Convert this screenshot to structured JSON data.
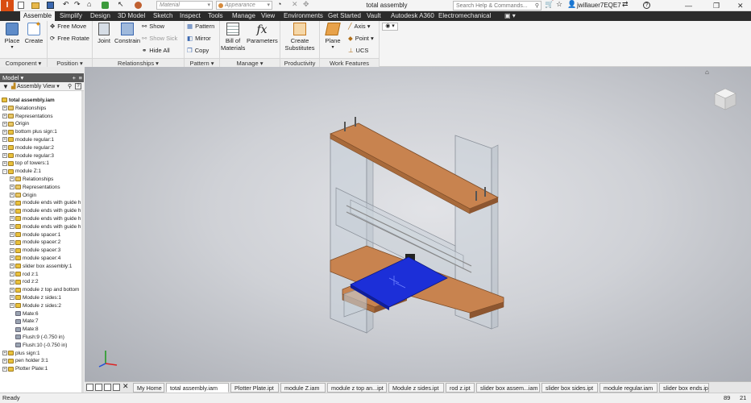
{
  "title_bar": {
    "material_placeholder": "Material",
    "appearance_placeholder": "Appearance",
    "doc_title": "total assembly",
    "search_placeholder": "Search Help & Commands...",
    "username": "jwillauer7EQE7",
    "help_label": "?"
  },
  "ribbon_tabs": [
    "Assemble",
    "Simplify",
    "Design",
    "3D Model",
    "Sketch",
    "Inspect",
    "Tools",
    "Manage",
    "View",
    "Environments",
    "Get Started",
    "Vault",
    "Autodesk A360",
    "Electromechanical"
  ],
  "ribbon": {
    "place": "Place",
    "create": "Create",
    "free_move": "Free Move",
    "free_rotate": "Free Rotate",
    "joint": "Joint",
    "constrain": "Constrain",
    "show": "Show",
    "show_sick": "Show Sick",
    "hide_all": "Hide All",
    "pattern": "Pattern",
    "mirror": "Mirror",
    "copy": "Copy",
    "bill_of_materials": "Bill of Materials",
    "parameters": "Parameters",
    "create_substitutes": "Create Substitutes",
    "plane": "Plane",
    "axis": "Axis",
    "point": "Point",
    "ucs": "UCS"
  },
  "panels": {
    "component": "Component",
    "position": "Position",
    "relationships": "Relationships",
    "pattern": "Pattern",
    "manage": "Manage",
    "productivity": "Productivity",
    "work_features": "Work Features"
  },
  "browser": {
    "header": "Model",
    "view": "Assembly View",
    "items": [
      {
        "label": "total assembly.iam",
        "depth": 0,
        "icon": "assembly",
        "exp": ""
      },
      {
        "label": "Relationships",
        "depth": 1,
        "icon": "folder",
        "exp": "+"
      },
      {
        "label": "Representations",
        "depth": 1,
        "icon": "folder",
        "exp": "+"
      },
      {
        "label": "Origin",
        "depth": 1,
        "icon": "folder",
        "exp": "+"
      },
      {
        "label": "bottom plus sign:1",
        "depth": 1,
        "icon": "part",
        "exp": "+"
      },
      {
        "label": "module regular:1",
        "depth": 1,
        "icon": "part",
        "exp": "+"
      },
      {
        "label": "module regular:2",
        "depth": 1,
        "icon": "part",
        "exp": "+"
      },
      {
        "label": "module regular:3",
        "depth": 1,
        "icon": "part",
        "exp": "+"
      },
      {
        "label": "top of towers:1",
        "depth": 1,
        "icon": "part",
        "exp": "+"
      },
      {
        "label": "module Z:1",
        "depth": 1,
        "icon": "assembly",
        "exp": "-"
      },
      {
        "label": "Relationships",
        "depth": 2,
        "icon": "folder",
        "exp": "+"
      },
      {
        "label": "Representations",
        "depth": 2,
        "icon": "folder",
        "exp": "+"
      },
      {
        "label": "Origin",
        "depth": 2,
        "icon": "folder",
        "exp": "+"
      },
      {
        "label": "module ends with guide h",
        "depth": 2,
        "icon": "part",
        "exp": "+"
      },
      {
        "label": "module ends with guide h",
        "depth": 2,
        "icon": "part",
        "exp": "+"
      },
      {
        "label": "module ends with guide h",
        "depth": 2,
        "icon": "part",
        "exp": "+"
      },
      {
        "label": "module ends with guide h",
        "depth": 2,
        "icon": "part",
        "exp": "+"
      },
      {
        "label": "module spacer:1",
        "depth": 2,
        "icon": "part",
        "exp": "+"
      },
      {
        "label": "module spacer:2",
        "depth": 2,
        "icon": "part",
        "exp": "+"
      },
      {
        "label": "module spacer:3",
        "depth": 2,
        "icon": "part",
        "exp": "+"
      },
      {
        "label": "module spacer:4",
        "depth": 2,
        "icon": "part",
        "exp": "+"
      },
      {
        "label": "slider box assembly:1",
        "depth": 2,
        "icon": "assembly",
        "exp": "+"
      },
      {
        "label": "rod z:1",
        "depth": 2,
        "icon": "part",
        "exp": "+"
      },
      {
        "label": "rod z:2",
        "depth": 2,
        "icon": "part",
        "exp": "+"
      },
      {
        "label": "module z top and bottom",
        "depth": 2,
        "icon": "part",
        "exp": "+"
      },
      {
        "label": "Module z sides:1",
        "depth": 2,
        "icon": "part",
        "exp": "+"
      },
      {
        "label": "Module z sides:2",
        "depth": 2,
        "icon": "part",
        "exp": "+"
      },
      {
        "label": "Mate:6",
        "depth": 2,
        "icon": "constraint",
        "exp": ""
      },
      {
        "label": "Mate:7",
        "depth": 2,
        "icon": "constraint",
        "exp": ""
      },
      {
        "label": "Mate:8",
        "depth": 2,
        "icon": "constraint",
        "exp": ""
      },
      {
        "label": "Flush:9 (-0.750 in)",
        "depth": 2,
        "icon": "constraint",
        "exp": ""
      },
      {
        "label": "Flush:10 (-0.750 in)",
        "depth": 2,
        "icon": "constraint",
        "exp": ""
      },
      {
        "label": "plus sign:1",
        "depth": 1,
        "icon": "part",
        "exp": "+"
      },
      {
        "label": "pen holder 3:1",
        "depth": 1,
        "icon": "part",
        "exp": "+"
      },
      {
        "label": "Plotter Plate:1",
        "depth": 1,
        "icon": "part",
        "exp": "+"
      }
    ]
  },
  "doc_tabs": [
    "My Home",
    "total assembly.iam",
    "Plotter Plate.ipt",
    "module Z.iam",
    "module z top an...ipt",
    "Module z sides.ipt",
    "rod z.ipt",
    "slider box assem...iam",
    "slider box sides.ipt",
    "module regular.iam",
    "slider box ends.ipt"
  ],
  "status": {
    "text": "Ready",
    "num1": "89",
    "num2": "21"
  },
  "colors": {
    "ribbon_tabs_bg": "#2b2b2b",
    "wood": "#c8834f",
    "plate_blue": "#1c2fd8",
    "glass": "#c7d0d8"
  }
}
